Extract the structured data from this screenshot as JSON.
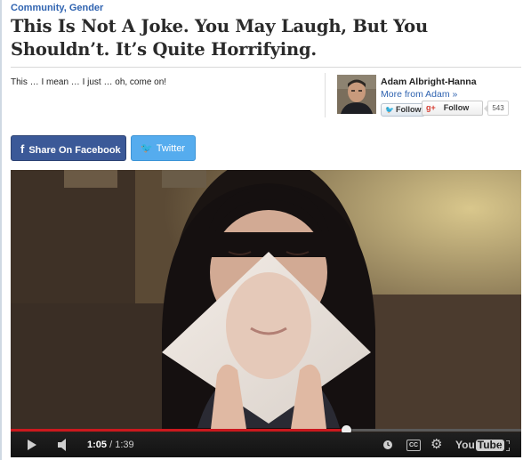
{
  "breadcrumb": {
    "category1": "Community",
    "separator": ", ",
    "category2": "Gender"
  },
  "article": {
    "title": "This Is Not A Joke. You May Laugh, But You Shouldn’t. It’s Quite Horrifying.",
    "subtitle": "This … I mean … I just … oh, come on!"
  },
  "author": {
    "name": "Adam Albright-Hanna",
    "more_link": "More from Adam »",
    "twitter_follow_label": "Follow",
    "gplus_label": "Follow",
    "gplus_count": "543"
  },
  "share": {
    "facebook_label": "Share On Facebook",
    "twitter_label": "Twitter"
  },
  "video": {
    "current_time": "1:05",
    "time_separator": " / ",
    "duration": "1:39",
    "progress_fraction": 0.6566,
    "cc_label": "CC",
    "logo_you": "You",
    "logo_tube": "Tube"
  },
  "colors": {
    "link_blue": "#2f63b0",
    "facebook_blue": "#3b5998",
    "twitter_blue": "#55acee",
    "progress_red": "#cc181e"
  },
  "icons": [
    "facebook-icon",
    "twitter-bird-icon",
    "google-plus-icon",
    "play-icon",
    "volume-icon",
    "clock-icon",
    "gear-icon",
    "fullscreen-icon"
  ]
}
